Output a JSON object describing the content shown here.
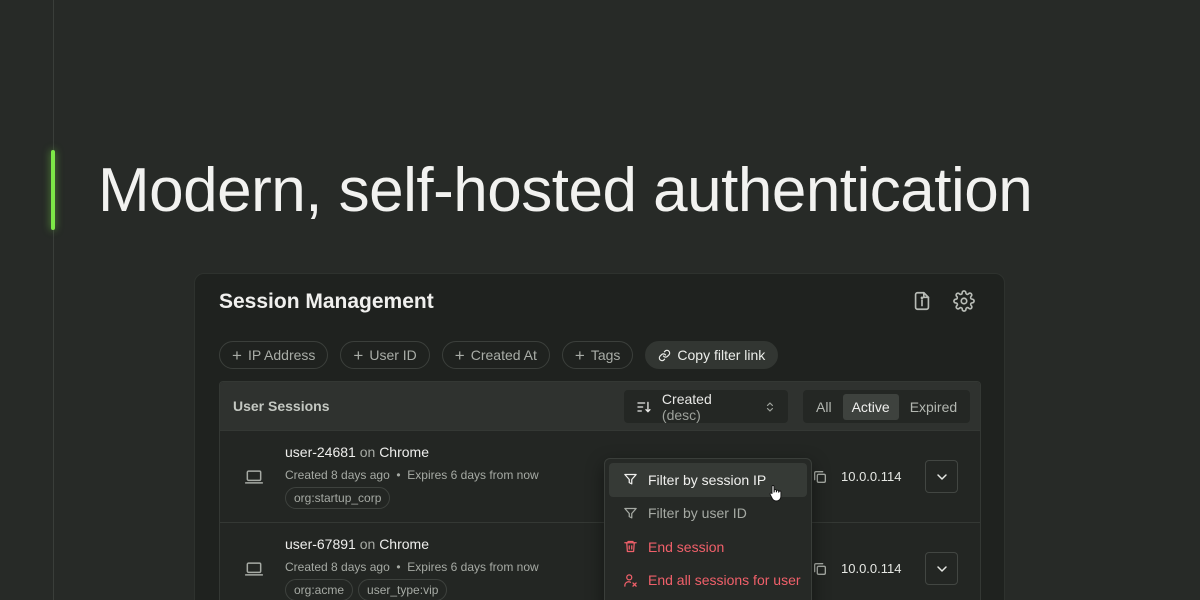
{
  "hero": {
    "headline": "Modern, self-hosted authentication"
  },
  "colors": {
    "accent": "#7de847",
    "danger": "#f0606a",
    "background": "#272a27"
  },
  "panel": {
    "title": "Session Management",
    "header_icons": [
      "file-info-icon",
      "gear-icon"
    ]
  },
  "filters": {
    "chips": [
      "IP Address",
      "User ID",
      "Created At",
      "Tags"
    ],
    "copy_link": "Copy filter link"
  },
  "sessions_table": {
    "title": "User Sessions",
    "sort": {
      "label": "Created",
      "direction": "(desc)"
    },
    "segments": [
      "All",
      "Active",
      "Expired"
    ],
    "selected_segment": "Active",
    "rows": [
      {
        "user": "user-24681",
        "on": "on",
        "browser": "Chrome",
        "created": "Created 8 days ago",
        "separator": "•",
        "expires": "Expires 6 days from now",
        "tags": [
          "org:startup_corp"
        ],
        "ip": "10.0.0.114"
      },
      {
        "user": "user-67891",
        "on": "on",
        "browser": "Chrome",
        "created": "Created 8 days ago",
        "separator": "•",
        "expires": "Expires 6 days from now",
        "tags": [
          "org:acme",
          "user_type:vip"
        ],
        "ip": "10.0.0.114"
      }
    ]
  },
  "context_menu": {
    "items": [
      {
        "label": "Filter by session IP",
        "icon": "filter-icon"
      },
      {
        "label": "Filter by user ID",
        "icon": "filter-icon"
      },
      {
        "label": "End session",
        "icon": "trash-icon"
      },
      {
        "label": "End all sessions for user",
        "icon": "user-remove-icon"
      }
    ]
  }
}
